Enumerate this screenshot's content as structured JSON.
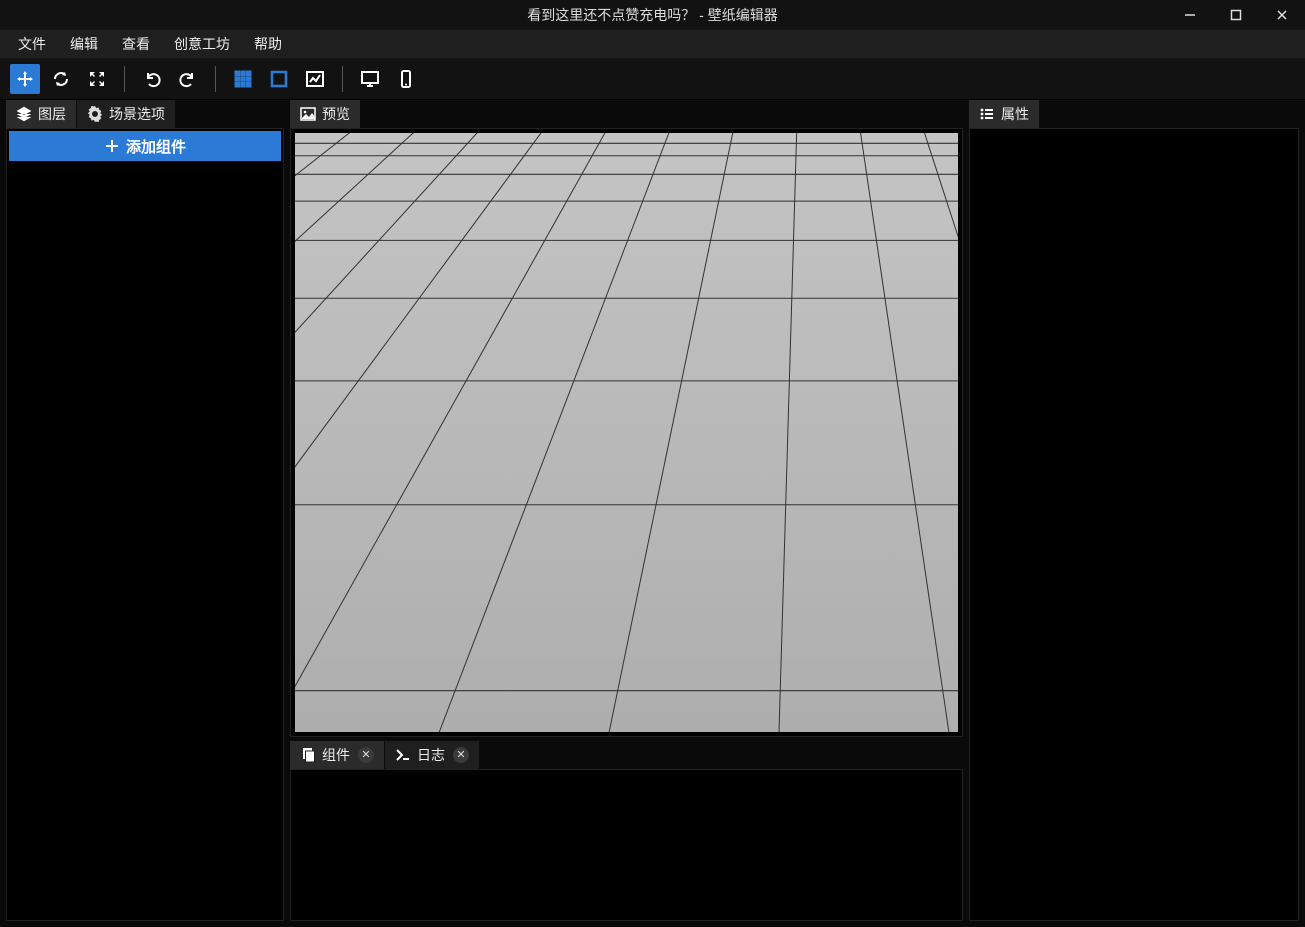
{
  "window": {
    "title": "看到这里还不点赞充电吗？ - 壁纸编辑器"
  },
  "menu": {
    "items": [
      "文件",
      "编辑",
      "查看",
      "创意工坊",
      "帮助"
    ]
  },
  "toolbar": {
    "icons": [
      "move",
      "refresh",
      "expand",
      "undo",
      "redo",
      "grid",
      "bounds",
      "stats",
      "monitor",
      "phone"
    ]
  },
  "left": {
    "tabs": {
      "layers": "图层",
      "scene": "场景选项"
    },
    "add_component": "添加组件"
  },
  "center": {
    "preview_tab": "预览",
    "bottom_tabs": {
      "components": "组件",
      "log": "日志"
    }
  },
  "right": {
    "properties_tab": "属性"
  },
  "colors": {
    "accent": "#2b7bd6",
    "panel": "#1f1f1f",
    "bg": "#0a0a0a"
  }
}
